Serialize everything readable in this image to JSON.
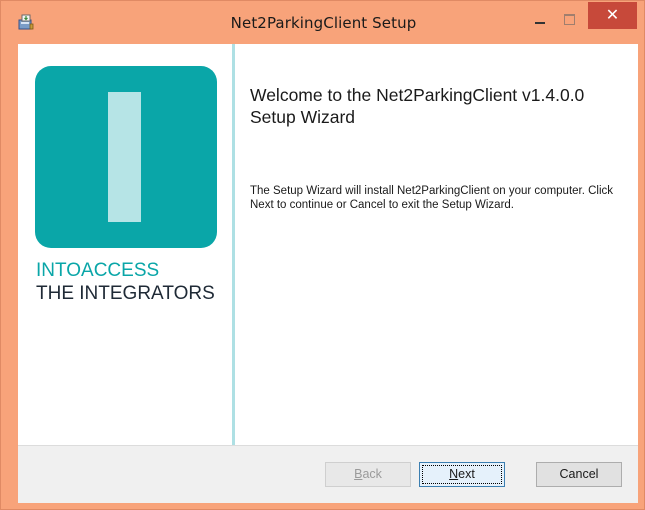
{
  "window": {
    "title": "Net2ParkingClient Setup",
    "close_glyph": "✕"
  },
  "branding": {
    "line1": "INTOACCESS",
    "line2": "THE INTEGRATORS",
    "accent_color": "#0aa6a8"
  },
  "content": {
    "heading": "Welcome to the Net2ParkingClient v1.4.0.0 Setup Wizard",
    "body": "The Setup Wizard will install Net2ParkingClient on your computer. Click Next to continue or Cancel to exit the Setup Wizard."
  },
  "buttons": {
    "back_accel": "B",
    "back_rest": "ack",
    "next_accel": "N",
    "next_rest": "ext",
    "cancel": "Cancel"
  },
  "icons": {
    "app": "installer-icon",
    "minimize": "minimize-icon",
    "maximize": "maximize-icon",
    "close": "close-icon"
  },
  "colors": {
    "titlebar": "#f8a37a",
    "close_button": "#c7493a",
    "sidebar_divider": "#aee0e4"
  }
}
